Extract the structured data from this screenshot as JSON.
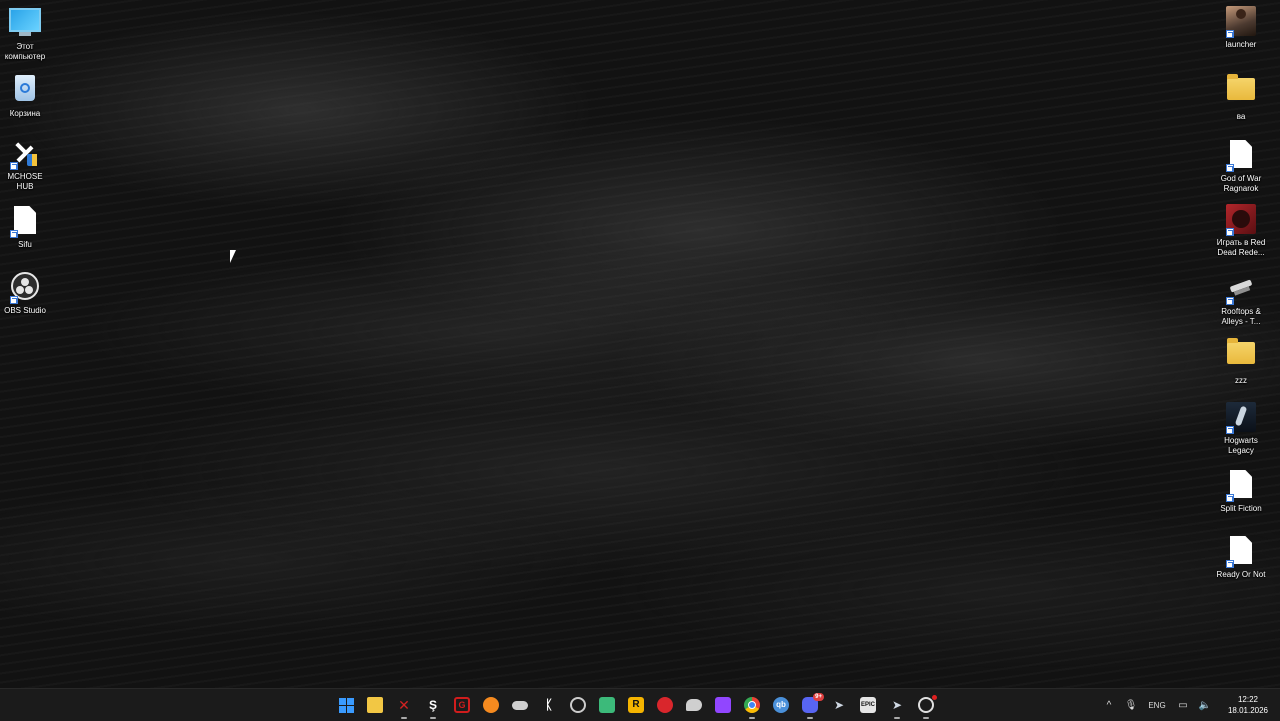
{
  "desktop": {
    "left_icons": [
      {
        "label": "Этот\nкомпьютер",
        "icon": "this-pc-icon"
      },
      {
        "label": "Корзина",
        "icon": "recycle-bin-icon"
      },
      {
        "label": "MCHOSE\nHUB",
        "icon": "mchose-hub-icon"
      },
      {
        "label": "Sifu",
        "icon": "file-icon"
      },
      {
        "label": "OBS Studio",
        "icon": "obs-studio-icon"
      }
    ],
    "right_icons": [
      {
        "label": "launcher",
        "icon": "launcher-icon"
      },
      {
        "label": "ва",
        "icon": "folder-icon"
      },
      {
        "label": "God of War\nRagnarok",
        "icon": "file-icon"
      },
      {
        "label": "Играть в Red\nDead Rede...",
        "icon": "red-dead-redemption-icon"
      },
      {
        "label": "Rooftops &\nAlleys - T...",
        "icon": "rooftops-alleys-icon"
      },
      {
        "label": "zzz",
        "icon": "folder-icon"
      },
      {
        "label": "Hogwarts\nLegacy",
        "icon": "hogwarts-legacy-icon"
      },
      {
        "label": "Split Fiction",
        "icon": "file-icon"
      },
      {
        "label": "Ready Or Not",
        "icon": "file-icon"
      }
    ]
  },
  "taskbar": {
    "apps": [
      {
        "icon": "windows-start-icon",
        "color": "#2f8cff"
      },
      {
        "icon": "file-explorer-icon",
        "color": "#f2c744"
      },
      {
        "icon": "red-game-app-icon",
        "color": "#d32222"
      },
      {
        "icon": "steelseries-gg-icon",
        "color": "#ffffff"
      },
      {
        "icon": "garena-icon",
        "color": "#d11d1d"
      },
      {
        "icon": "orange-app-icon",
        "color": "#f58a1f"
      },
      {
        "icon": "gamepad-icon",
        "color": "#cfcfcf"
      },
      {
        "icon": "mchose-hub-icon",
        "color": "#ffffff"
      },
      {
        "icon": "ring-app-icon",
        "color": "#cccccc"
      },
      {
        "icon": "green-app-icon",
        "color": "#3cba7a"
      },
      {
        "icon": "rockstar-launcher-icon",
        "color": "#f5b400"
      },
      {
        "icon": "red-box-app-icon",
        "color": "#d9262c"
      },
      {
        "icon": "chat-bubble-icon",
        "color": "#cfcfcf"
      },
      {
        "icon": "twitch-icon",
        "color": "#9146ff"
      },
      {
        "icon": "chrome-icon",
        "color": "#34a853"
      },
      {
        "icon": "qbittorrent-icon",
        "color": "#4a90d9"
      },
      {
        "icon": "discord-icon",
        "color": "#5865f2",
        "badge": "9+"
      },
      {
        "icon": "steam-icon",
        "color": "#cfd8e3"
      },
      {
        "icon": "epic-games-icon",
        "color": "#e5e5e5"
      },
      {
        "icon": "steam-icon",
        "color": "#cfd8e3"
      },
      {
        "icon": "obs-studio-icon",
        "color": "#e0e0e0"
      }
    ],
    "tray": {
      "chevron": "^",
      "mic_icon": "microphone-icon",
      "language": "ENG",
      "network_icon": "monitor-network-icon",
      "volume_icon": "speaker-icon",
      "time": "12:22",
      "date": "18.01.2026"
    }
  }
}
